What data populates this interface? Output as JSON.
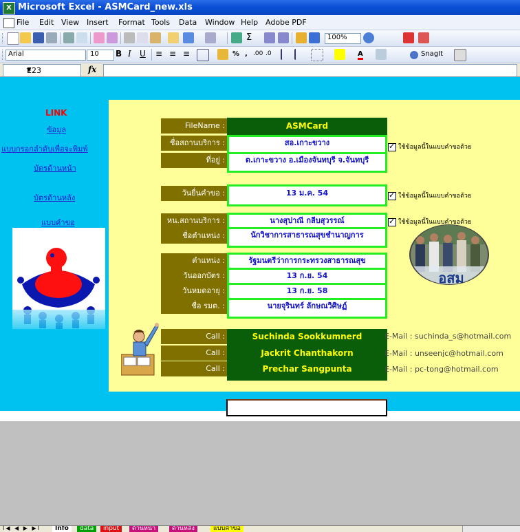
{
  "window": {
    "title": "Microsoft Excel - ASMCard_new.xls"
  },
  "menu": [
    "File",
    "Edit",
    "View",
    "Insert",
    "Format",
    "Tools",
    "Data",
    "Window",
    "Help",
    "Adobe PDF"
  ],
  "toolbar": {
    "zoom": "100%",
    "font_name": "Arial",
    "font_size": "10",
    "snagit": "SnagIt"
  },
  "formula_bar": {
    "cell_ref": "E23",
    "fx": "fx"
  },
  "links": {
    "title": "LINK",
    "items": [
      "ข้อมูล",
      "แบบกรอกลำดับเพื่อจะพิมพ์",
      "บัตรด้านหน้า",
      "บัตรด้านหลัง",
      "แบบคำขอ"
    ]
  },
  "form": {
    "filename_label": "FileName :",
    "filename": "ASMCard",
    "service_name_label": "ชื่อสถานบริการ :",
    "service_name": "สอ.เกาะขวาง",
    "address_label": "ที่อยู่ :",
    "address": "ต.เกาะขวาง อ.เมืองจันทบุรี จ.จันทบุรี",
    "request_date_label": "วันยื่นคำขอ :",
    "request_date": "13 ม.ค. 54",
    "head_label": "หน.สถานบริการ :",
    "head_name": "นางสุปาณี  กลีบสุวรรณ์",
    "position_label": "ชื่อตำแหน่ง :",
    "position": "นักวิชาการสาธารณสุขชำนาญการ",
    "title_label": "ตำแหน่ง :",
    "title_value": "รัฐมนตรีว่าการกระทรวงสาธารณสุข",
    "issue_label": "วันออกบัตร :",
    "issue_date": "13 ก.ย. 54",
    "expire_label": "วันหมดอายุ :",
    "expire_date": "13 ก.ย. 58",
    "minister_label": "ชื่อ รมต. :",
    "minister_name": "นายจุรินทร์ ลักษณวิศิษฏ์",
    "use_in_form": "ใช้ข้อมูลนี้ในแบบคำขอด้วย"
  },
  "contacts": [
    {
      "call": "Call :",
      "name": "Suchinda Sookkumnerd",
      "email": "E-Mail : suchinda_s@hotmail.com"
    },
    {
      "call": "Call :",
      "name": "Jackrit Chanthakorn",
      "email": "E-Mail : unseenjc@hotmail.com"
    },
    {
      "call": "Call :",
      "name": "Prechar Sangpunta",
      "email": "E-Mail : pc-tong@hotmail.com"
    }
  ],
  "photo_caption": "อสม",
  "sheet_tabs": [
    "Info",
    "data",
    "input",
    "ด้านหน้า",
    "ด้านหลัง",
    "แบบคำขอ"
  ],
  "colors": {
    "title_bar": "#0a4fd6",
    "sheet_bg": "#00c2f0",
    "panel_bg": "#ffff99",
    "label_bg": "#807000",
    "value_border": "#22ee22",
    "dark_value_bg": "#0a5e0a"
  }
}
